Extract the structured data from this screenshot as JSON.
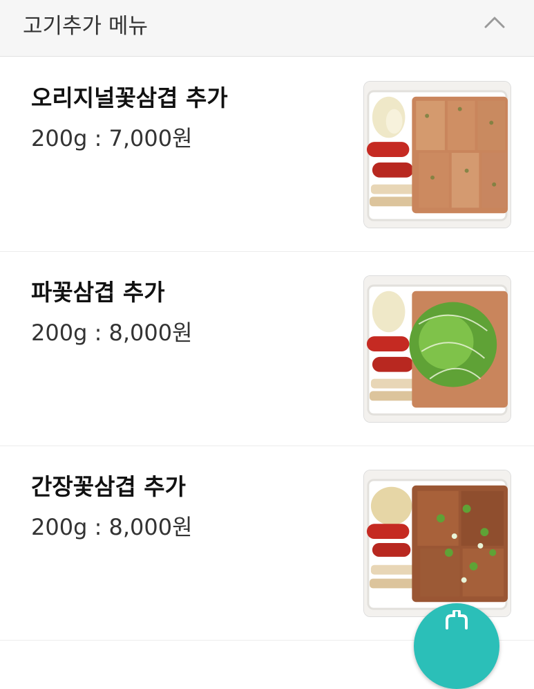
{
  "section": {
    "title": "고기추가 메뉴",
    "collapse_icon": "chevron-up-icon"
  },
  "items": [
    {
      "name": "오리지널꽃삼겹 추가",
      "price": "200g : 7,000원",
      "thumbnail_icon": "food-photo-original"
    },
    {
      "name": "파꽃삼겹 추가",
      "price": "200g : 8,000원",
      "thumbnail_icon": "food-photo-green-onion"
    },
    {
      "name": "간장꽃삼겹 추가",
      "price": "200g : 8,000원",
      "thumbnail_icon": "food-photo-soy-sauce"
    }
  ],
  "fab": {
    "icon": "fab-icon",
    "color": "#2bbfb8"
  }
}
